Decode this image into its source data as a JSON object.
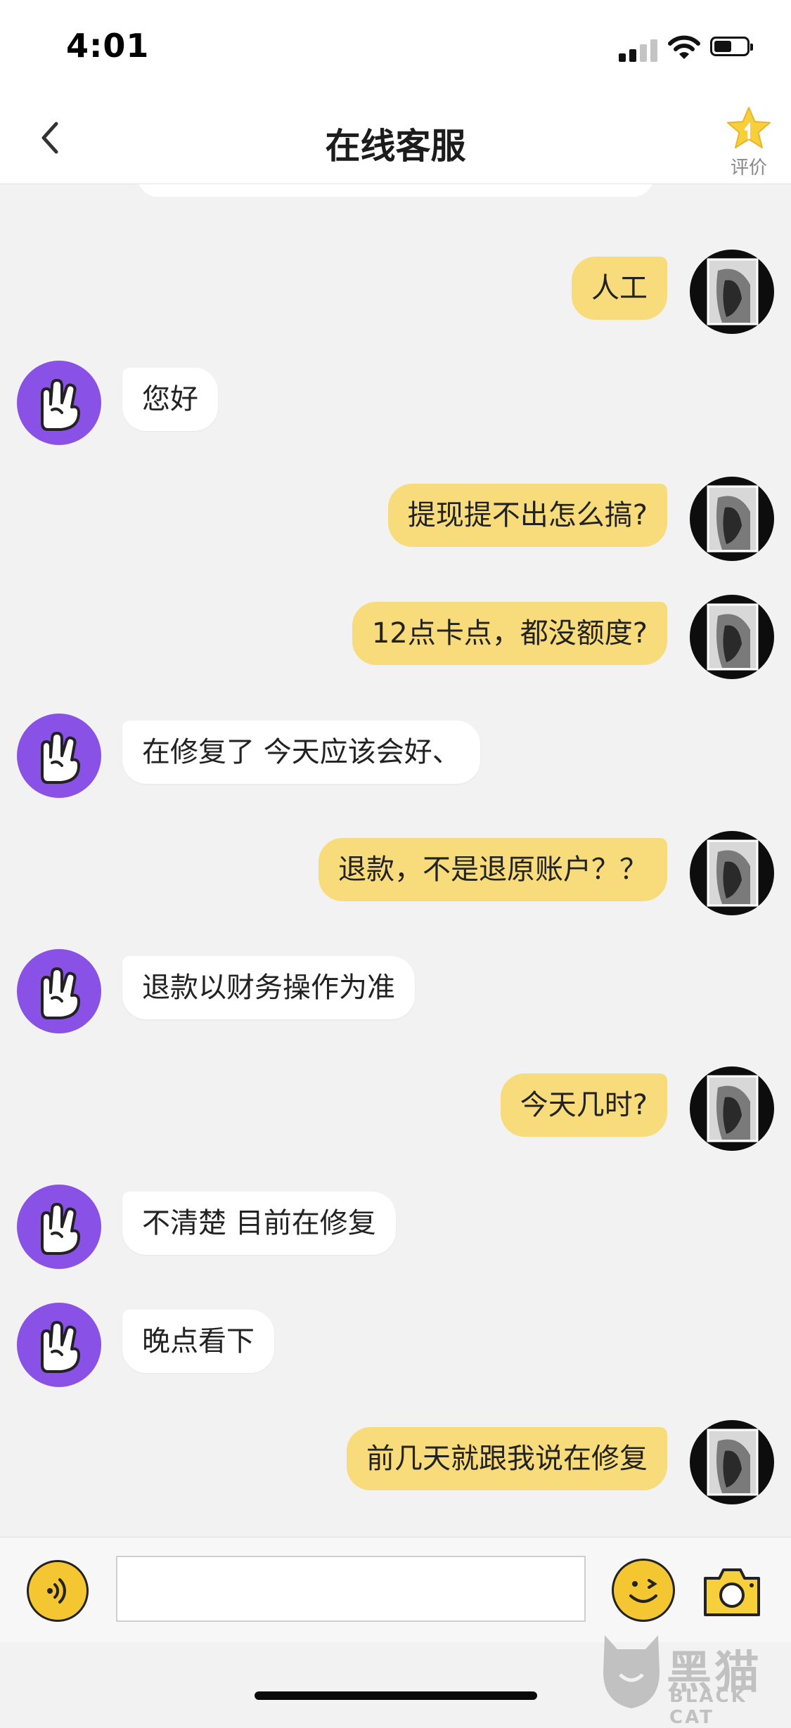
{
  "status_bar": {
    "time": "4:01"
  },
  "nav": {
    "title": "在线客服",
    "rate_label": "评价"
  },
  "messages": [
    {
      "from": "user",
      "text": "人工"
    },
    {
      "from": "agent",
      "text": "您好"
    },
    {
      "from": "user",
      "text": "提现提不出怎么搞?"
    },
    {
      "from": "user",
      "text": "12点卡点，都没额度?"
    },
    {
      "from": "agent",
      "text": "在修复了  今天应该会好、"
    },
    {
      "from": "user",
      "text": "退款，不是退原账户？？"
    },
    {
      "from": "agent",
      "text": "退款以财务操作为准"
    },
    {
      "from": "user",
      "text": "今天几时?"
    },
    {
      "from": "agent",
      "text": "不清楚 目前在修复"
    },
    {
      "from": "agent",
      "text": "晚点看下"
    },
    {
      "from": "user",
      "text": "前几天就跟我说在修复"
    }
  ],
  "input": {
    "placeholder": "",
    "value": ""
  },
  "watermark": {
    "brand": "黑猫",
    "sub": "BLACK CAT"
  },
  "colors": {
    "user_bubble": "#f8dc7c",
    "agent_bubble": "#ffffff",
    "accent": "#f4c631",
    "agent_avatar": "#8a51e6"
  },
  "icons": {
    "back": "chevron-left-icon",
    "rate": "star-icon",
    "voice": "voice-icon",
    "emoji": "emoji-icon",
    "camera": "camera-icon"
  }
}
